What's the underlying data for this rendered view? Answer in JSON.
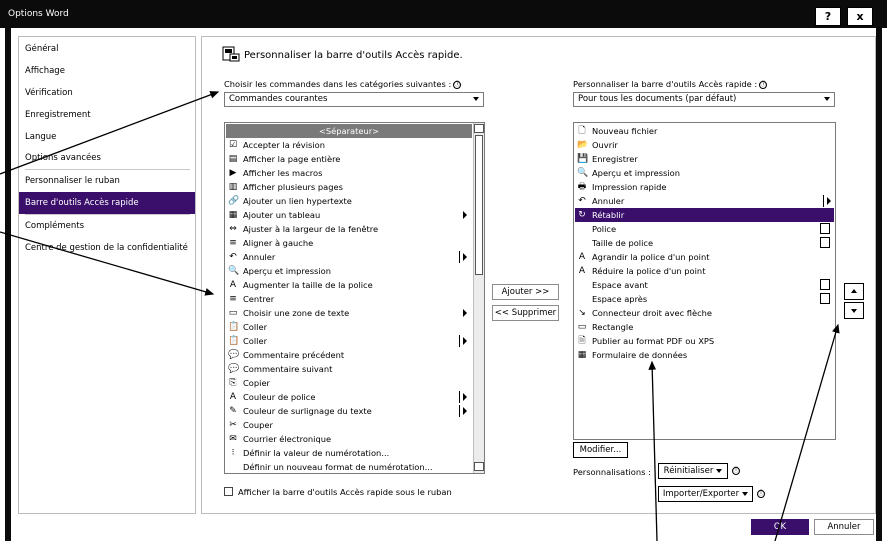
{
  "window": {
    "title": "Options Word",
    "help_label": "?",
    "close_label": "x"
  },
  "nav": {
    "items": [
      {
        "label": "Général"
      },
      {
        "label": "Affichage"
      },
      {
        "label": "Vérification"
      },
      {
        "label": "Enregistrement"
      },
      {
        "label": "Langue"
      },
      {
        "label": "Options avancées"
      },
      {
        "label": "Personnaliser le ruban"
      },
      {
        "label": "Barre d'outils Accès rapide"
      },
      {
        "label": "Compléments"
      },
      {
        "label": "Centre de gestion de la confidentialité"
      }
    ],
    "selected_index": 7
  },
  "main": {
    "header": "Personnaliser la barre d'outils Accès rapide.",
    "left_label": "Choisir les commandes dans les catégories suivantes :",
    "left_select": "Commandes courantes",
    "right_label": "Personnaliser la barre d'outils Accès rapide :",
    "right_select": "Pour tous les documents (par défaut)",
    "info_glyph": "ⓘ",
    "commands": [
      {
        "label": "<Séparateur>",
        "icon": "",
        "sub": ""
      },
      {
        "label": "Accepter la révision",
        "icon": "☑",
        "sub": ""
      },
      {
        "label": "Afficher la page entière",
        "icon": "▤",
        "sub": ""
      },
      {
        "label": "Afficher les macros",
        "icon": "▶",
        "sub": ""
      },
      {
        "label": "Afficher plusieurs pages",
        "icon": "▥",
        "sub": ""
      },
      {
        "label": "Ajouter un lien hypertexte",
        "icon": "🔗",
        "sub": ""
      },
      {
        "label": "Ajouter un tableau",
        "icon": "▦",
        "sub": "arrow"
      },
      {
        "label": "Ajuster à la largeur de la fenêtre",
        "icon": "⇔",
        "sub": ""
      },
      {
        "label": "Aligner à gauche",
        "icon": "≡",
        "sub": ""
      },
      {
        "label": "Annuler",
        "icon": "↶",
        "sub": "bar"
      },
      {
        "label": "Aperçu et impression",
        "icon": "🔍",
        "sub": ""
      },
      {
        "label": "Augmenter la taille de la police",
        "icon": "A",
        "sub": ""
      },
      {
        "label": "Centrer",
        "icon": "≡",
        "sub": ""
      },
      {
        "label": "Choisir une zone de texte",
        "icon": "▭",
        "sub": "arrow"
      },
      {
        "label": "Coller",
        "icon": "📋",
        "sub": ""
      },
      {
        "label": "Coller",
        "icon": "📋",
        "sub": "bar"
      },
      {
        "label": "Commentaire précédent",
        "icon": "💬",
        "sub": ""
      },
      {
        "label": "Commentaire suivant",
        "icon": "💬",
        "sub": ""
      },
      {
        "label": "Copier",
        "icon": "⎘",
        "sub": ""
      },
      {
        "label": "Couleur de police",
        "icon": "A",
        "sub": "bar"
      },
      {
        "label": "Couleur de surlignage du texte",
        "icon": "✎",
        "sub": "bar"
      },
      {
        "label": "Couper",
        "icon": "✂",
        "sub": ""
      },
      {
        "label": "Courrier électronique",
        "icon": "✉",
        "sub": ""
      },
      {
        "label": "Définir la valeur de numérotation...",
        "icon": "⁝",
        "sub": ""
      },
      {
        "label": "Définir un nouveau format de numérotation...",
        "icon": "",
        "sub": ""
      }
    ],
    "qat_items": [
      {
        "label": "Nouveau fichier",
        "icon": "🗋",
        "sub": ""
      },
      {
        "label": "Ouvrir",
        "icon": "📂",
        "sub": ""
      },
      {
        "label": "Enregistrer",
        "icon": "💾",
        "sub": ""
      },
      {
        "label": "Aperçu et impression",
        "icon": "🔍",
        "sub": ""
      },
      {
        "label": "Impression rapide",
        "icon": "🖶",
        "sub": ""
      },
      {
        "label": "Annuler",
        "icon": "↶",
        "sub": "bar"
      },
      {
        "label": "Rétablir",
        "icon": "↻",
        "sub": ""
      },
      {
        "label": "Police",
        "icon": "",
        "sub": "mini"
      },
      {
        "label": "Taille de police",
        "icon": "",
        "sub": "mini"
      },
      {
        "label": "Agrandir la police d'un point",
        "icon": "A",
        "sub": ""
      },
      {
        "label": "Réduire la police d'un point",
        "icon": "A",
        "sub": ""
      },
      {
        "label": "Espace avant",
        "icon": "",
        "sub": "mini"
      },
      {
        "label": "Espace après",
        "icon": "",
        "sub": "mini"
      },
      {
        "label": "Connecteur droit avec flèche",
        "icon": "↘",
        "sub": ""
      },
      {
        "label": "Rectangle",
        "icon": "▭",
        "sub": ""
      },
      {
        "label": "Publier au format PDF ou XPS",
        "icon": "🗎",
        "sub": ""
      },
      {
        "label": "Formulaire de données",
        "icon": "▦",
        "sub": ""
      }
    ],
    "qat_selected_index": 6,
    "add_button": "Ajouter >>",
    "remove_button": "<< Supprimer",
    "modify_button": "Modifier...",
    "customizations_label": "Personnalisations :",
    "reset_button": "Réinitialiser",
    "import_export_button": "Importer/Exporter",
    "show_below_ribbon": "Afficher la barre d'outils Accès rapide sous le ruban",
    "ok_button": "OK",
    "cancel_button": "Annuler"
  }
}
